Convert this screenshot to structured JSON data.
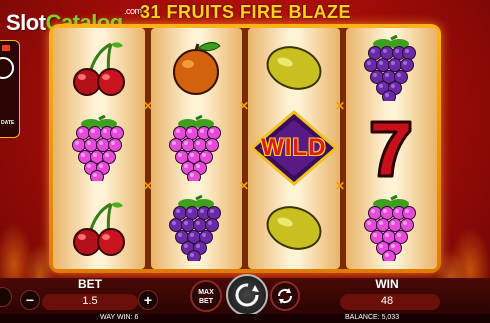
{
  "logo": {
    "part1": "Slot",
    "part2": "Catalog",
    "suffix": ".com"
  },
  "game": {
    "title": "31 FRUITS FIRE BLAZE"
  },
  "side_menu": {
    "label": "DATE"
  },
  "reels": [
    [
      "cherry",
      "grapes",
      "cherry"
    ],
    [
      "orange",
      "grapes",
      "grapes-dark"
    ],
    [
      "lemon",
      "wild",
      "lemon"
    ],
    [
      "grapes-dark",
      "seven",
      "grapes"
    ]
  ],
  "wild_label": "WILD",
  "bet": {
    "label": "BET",
    "value": "1.5",
    "minus": "−",
    "plus": "+"
  },
  "max_bet": {
    "line1": "MAX",
    "line2": "BET"
  },
  "win": {
    "label": "WIN",
    "value": "48"
  },
  "status": {
    "way_win": "WAY WIN: 6",
    "balance": "BALANCE: 5,033"
  },
  "colors": {
    "accent": "#ffd21e",
    "frame": "#ffb21a",
    "background": "#a50d08"
  }
}
